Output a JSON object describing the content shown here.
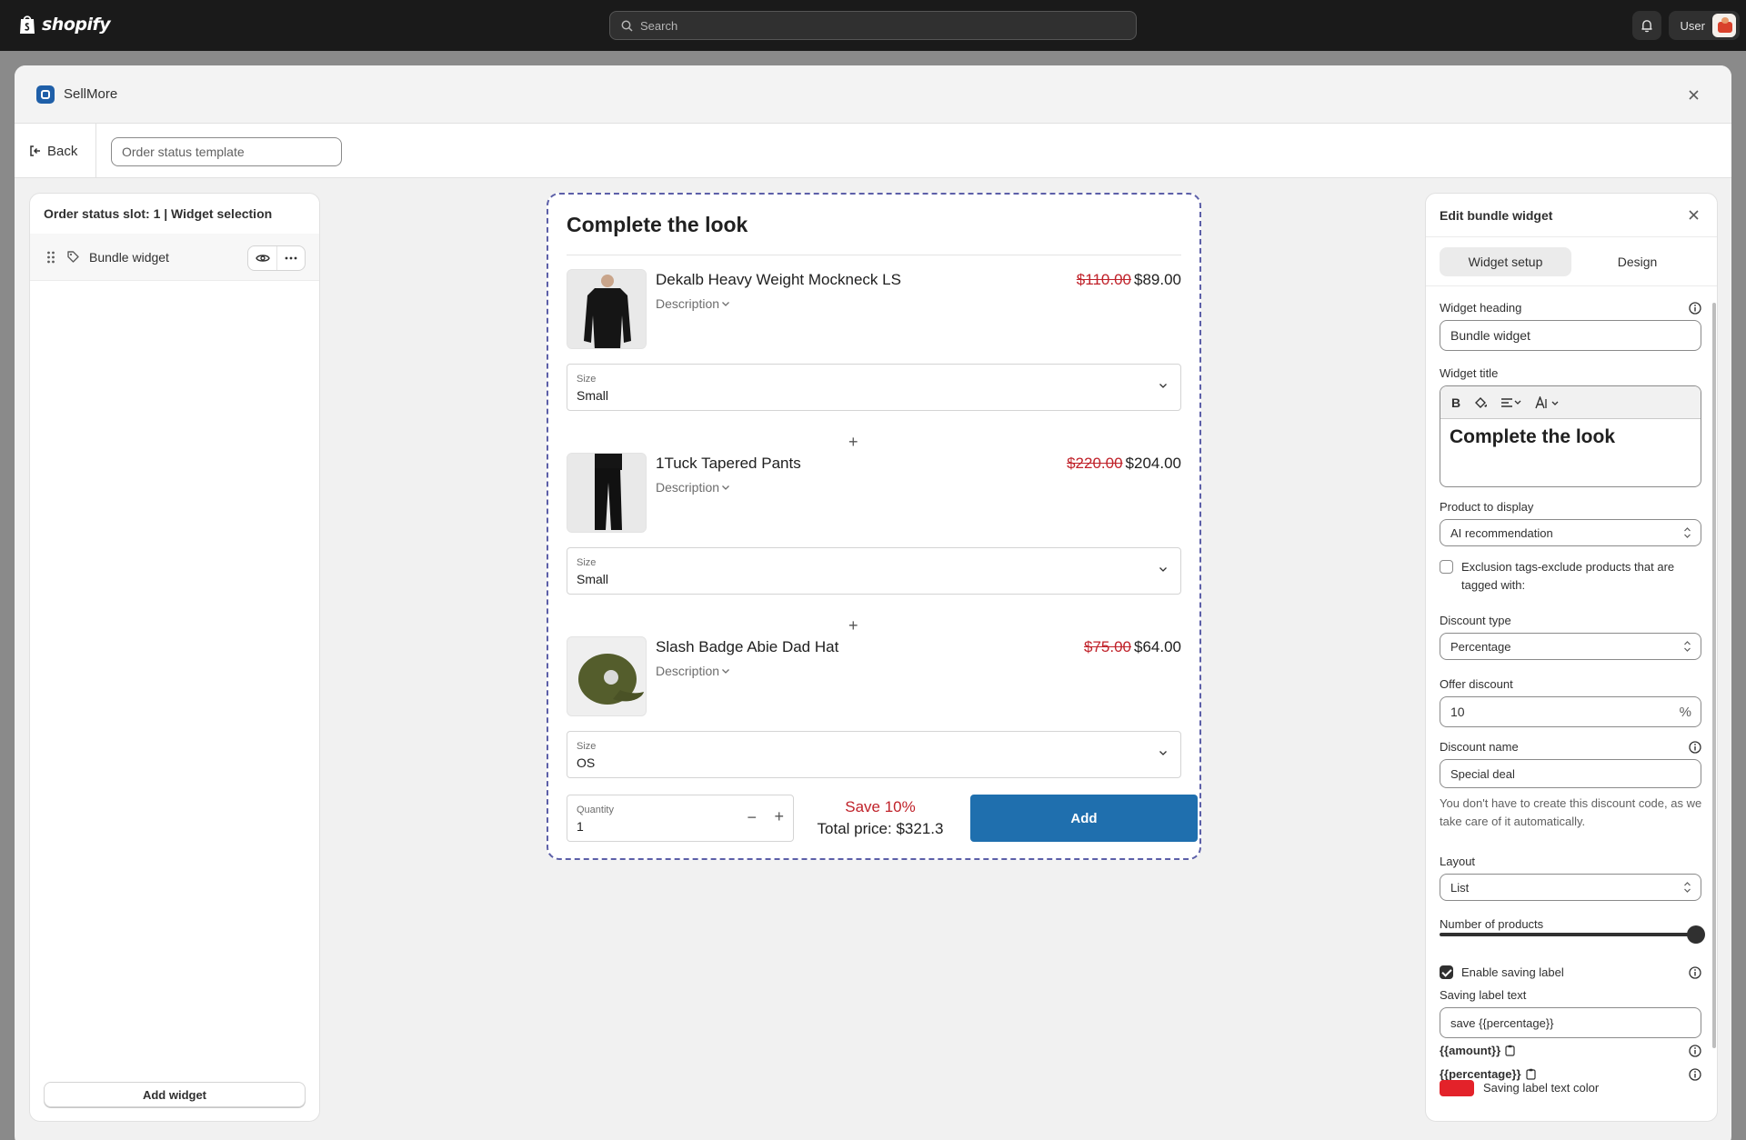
{
  "topbar": {
    "brand": "shopify",
    "search_placeholder": "Search",
    "user_label": "User"
  },
  "modal": {
    "app_name": "SellMore",
    "back_label": "Back",
    "template_placeholder": "Order status template"
  },
  "left_panel": {
    "title": "Order status slot: 1 | Widget selection",
    "widget_label": "Bundle widget",
    "add_widget_label": "Add widget"
  },
  "preview": {
    "title": "Complete the look",
    "products": [
      {
        "name": "Dekalb Heavy Weight Mockneck LS",
        "description": "Description",
        "old_price": "$110.00",
        "price": "$89.00",
        "size_label": "Size",
        "size_value": "Small"
      },
      {
        "name": "1Tuck Tapered Pants",
        "description": "Description",
        "old_price": "$220.00",
        "price": "$204.00",
        "size_label": "Size",
        "size_value": "Small"
      },
      {
        "name": "Slash Badge Abie Dad Hat",
        "description": "Description",
        "old_price": "$75.00",
        "price": "$64.00",
        "size_label": "Size",
        "size_value": "OS"
      }
    ],
    "quantity_label": "Quantity",
    "quantity_value": "1",
    "save_text": "Save 10%",
    "total_text": "Total price: $321.3",
    "add_label": "Add"
  },
  "editor": {
    "title": "Edit bundle widget",
    "tabs": [
      "Widget setup",
      "Design"
    ],
    "widget_heading_label": "Widget heading",
    "widget_heading_value": "Bundle widget",
    "widget_title_label": "Widget title",
    "widget_title_value": "Complete the look",
    "product_display_label": "Product to display",
    "product_display_value": "AI recommendation",
    "exclusion_label": "Exclusion tags-exclude products that are tagged with:",
    "discount_type_label": "Discount type",
    "discount_type_value": "Percentage",
    "offer_discount_label": "Offer discount",
    "offer_discount_value": "10",
    "offer_discount_suffix": "%",
    "discount_name_label": "Discount name",
    "discount_name_value": "Special deal",
    "discount_help": "You don't have to create this discount code, as we take care of it automatically.",
    "layout_label": "Layout",
    "layout_value": "List",
    "num_products_label": "Number of products",
    "num_products_level": 1.0,
    "enable_saving_label": "Enable saving label",
    "saving_text_label": "Saving label text",
    "saving_text_value": "save {{percentage}}",
    "token_amount": "{{amount}}",
    "token_percentage": "{{percentage}}",
    "saving_color_label": "Saving label text color",
    "saving_color": "#e3222a"
  }
}
